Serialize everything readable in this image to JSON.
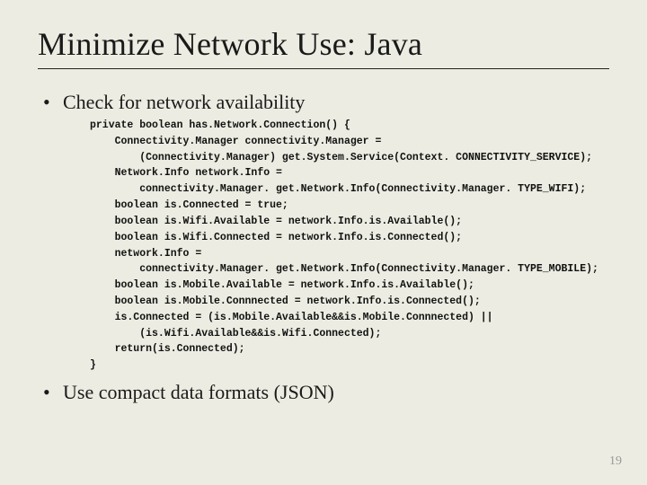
{
  "title": "Minimize Network Use: Java",
  "bullets": {
    "b1": "Check for network availability",
    "b2": "Use compact data formats (JSON)"
  },
  "code": "private boolean has.Network.Connection() {\n    Connectivity.Manager connectivity.Manager =\n        (Connectivity.Manager) get.System.Service(Context. CONNECTIVITY_SERVICE);\n    Network.Info network.Info =\n        connectivity.Manager. get.Network.Info(Connectivity.Manager. TYPE_WIFI);\n    boolean is.Connected = true;\n    boolean is.Wifi.Available = network.Info.is.Available();\n    boolean is.Wifi.Connected = network.Info.is.Connected();\n    network.Info =\n        connectivity.Manager. get.Network.Info(Connectivity.Manager. TYPE_MOBILE);\n    boolean is.Mobile.Available = network.Info.is.Available();\n    boolean is.Mobile.Connnected = network.Info.is.Connected();\n    is.Connected = (is.Mobile.Available&&is.Mobile.Connnected) ||\n        (is.Wifi.Available&&is.Wifi.Connected);\n    return(is.Connected);\n}",
  "page_number": "19"
}
